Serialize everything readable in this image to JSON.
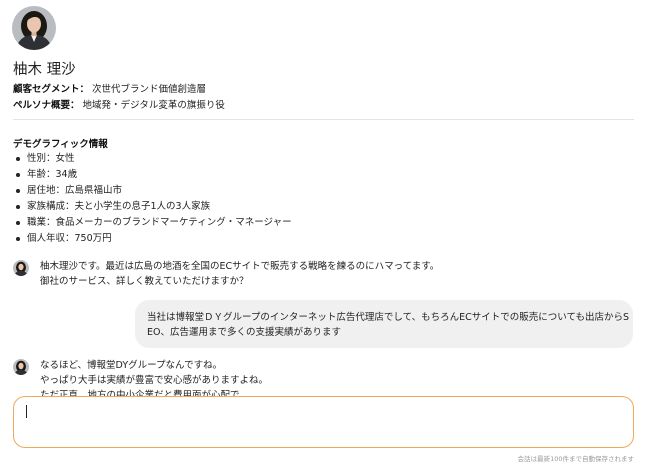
{
  "persona": {
    "name": "柚木 理沙",
    "segment_label": "顧客セグメント：",
    "segment_value": "次世代ブランド価値創造層",
    "persona_label": "ペルソナ概要：",
    "persona_value": "地域発・デジタル変革の旗振り役"
  },
  "demographics": {
    "title": "デモグラフィック情報",
    "items": [
      "性別：女性",
      "年齢：34歳",
      "居住地：広島県福山市",
      "家族構成：夫と小学生の息子1人の3人家族",
      "職業：食品メーカーのブランドマーケティング・マネージャー",
      "個人年収：750万円"
    ]
  },
  "chat": {
    "messages": [
      {
        "role": "persona",
        "lines": [
          "柚木理沙です。最近は広島の地酒を全国のECサイトで販売する戦略を練るのにハマってます。",
          "御社のサービス、詳しく教えていただけますか？"
        ]
      },
      {
        "role": "user",
        "lines": [
          "当社は博報堂ＤＹグループのインターネット広告代理店でして、もちろんECサイトでの販売についても出店からS",
          "EO、広告運用まで多くの支援実績があります"
        ]
      },
      {
        "role": "persona",
        "lines": [
          "なるほど、博報堂DYグループなんですね。",
          "やっぱり大手は実績が豊富で安心感がありますよね。",
          "ただ正直、地方の中小企業だと費用面が心配で"
        ]
      }
    ],
    "input_value": "",
    "footer_note": "会話は最新100件まで自動保存されます",
    "input_border_color": "#f0a85a",
    "user_bubble_color": "#f0f0f0"
  }
}
